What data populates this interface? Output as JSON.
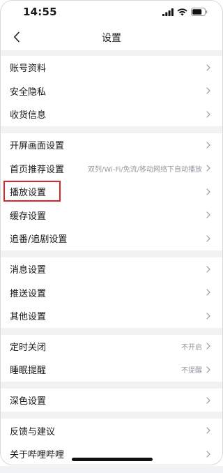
{
  "status": {
    "time": "14:55"
  },
  "nav": {
    "title": "设置"
  },
  "groups": [
    [
      {
        "label": "账号资料",
        "value": ""
      },
      {
        "label": "安全隐私",
        "value": ""
      },
      {
        "label": "收货信息",
        "value": ""
      }
    ],
    [
      {
        "label": "开屏画面设置",
        "value": ""
      },
      {
        "label": "首页推荐设置",
        "value": "双列/Wi-Fi/免流/移动网络下自动播放"
      },
      {
        "label": "播放设置",
        "value": "",
        "highlighted": true
      },
      {
        "label": "缓存设置",
        "value": ""
      },
      {
        "label": "追番/追剧设置",
        "value": ""
      }
    ],
    [
      {
        "label": "消息设置",
        "value": ""
      },
      {
        "label": "推送设置",
        "value": ""
      },
      {
        "label": "其他设置",
        "value": ""
      }
    ],
    [
      {
        "label": "定时关闭",
        "value": "不开启"
      },
      {
        "label": "睡眠提醒",
        "value": "不提醒"
      }
    ],
    [
      {
        "label": "深色设置",
        "value": ""
      }
    ],
    [
      {
        "label": "反馈与建议",
        "value": ""
      },
      {
        "label": "关于哔哩哔哩",
        "value": ""
      }
    ]
  ],
  "colors": {
    "background": "#f1f2f3",
    "row_background": "#ffffff",
    "text": "#18191c",
    "secondary_text": "#9499a0",
    "highlight_border": "#d8262d"
  }
}
